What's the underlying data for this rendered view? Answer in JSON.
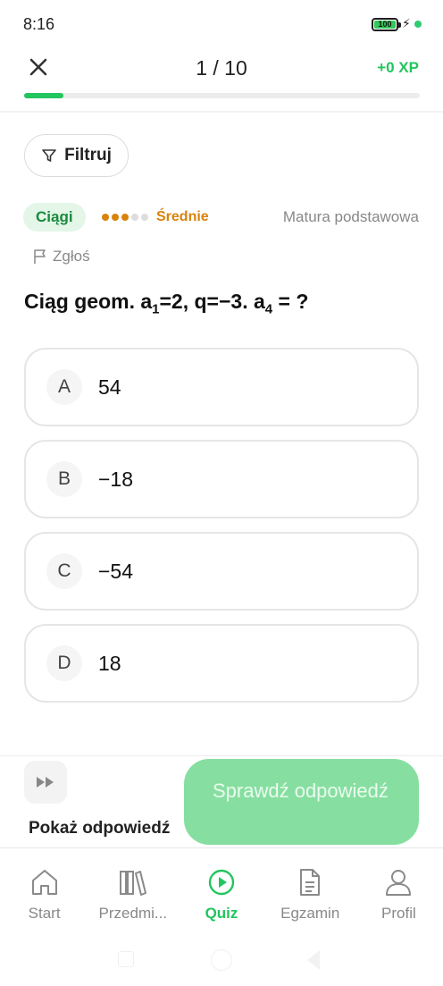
{
  "status_bar": {
    "time": "8:16",
    "battery": "100",
    "charging_icon": "bolt-icon"
  },
  "header": {
    "counter": "1 / 10",
    "xp": "+0 XP",
    "progress": 0.1,
    "close_icon": "close-icon"
  },
  "filter": {
    "label": "Filtruj",
    "icon": "filter-icon"
  },
  "tags": {
    "topic": "Ciągi",
    "difficulty": {
      "label": "Średnie",
      "level": 3,
      "max": 5
    },
    "exam": "Matura podstawowa",
    "report": "Zgłoś"
  },
  "question": {
    "part1": "Ciąg geom. a",
    "sub1": "1",
    "part2": "=2, q=−3. a",
    "sub2": "4",
    "part3": " = ?"
  },
  "options": [
    {
      "letter": "A",
      "value": "54"
    },
    {
      "letter": "B",
      "value": "−18"
    },
    {
      "letter": "C",
      "value": "−54"
    },
    {
      "letter": "D",
      "value": "18"
    }
  ],
  "actions": {
    "show_answer": "Pokaż odpowiedź",
    "check": "Sprawdź odpowiedź"
  },
  "nav": [
    {
      "label": "Start",
      "icon": "home-icon"
    },
    {
      "label": "Przedmi...",
      "icon": "books-icon"
    },
    {
      "label": "Quiz",
      "icon": "play-circle-icon",
      "active": true
    },
    {
      "label": "Egzamin",
      "icon": "document-icon"
    },
    {
      "label": "Profil",
      "icon": "user-icon"
    }
  ],
  "colors": {
    "accent": "#22c55e",
    "difficulty": "#d9820c",
    "topic_bg": "#e3f6e8"
  }
}
